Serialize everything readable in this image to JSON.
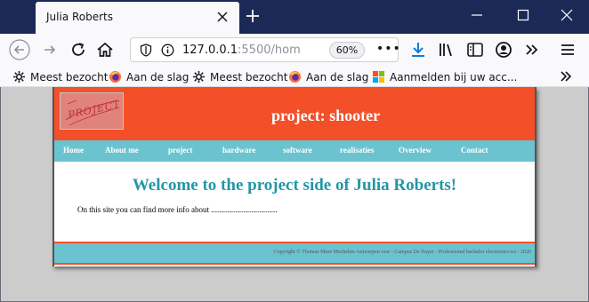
{
  "browser": {
    "tab_title": "Julia Roberts",
    "url_main": "127.0.0.1",
    "url_rest": ":5500/hom",
    "zoom": "60%",
    "accent": "#0b7dd8"
  },
  "bookmarks": [
    {
      "label": "Meest bezocht",
      "icon": "gear-icon"
    },
    {
      "label": "Aan de slag",
      "icon": "firefox-icon"
    },
    {
      "label": "Meest bezocht",
      "icon": "gear-icon"
    },
    {
      "label": "Aan de slag",
      "icon": "firefox-icon"
    },
    {
      "label": "Aanmelden bij uw acc...",
      "icon": "windows-icon"
    }
  ],
  "site": {
    "logo_text": "PROJECT",
    "title": "project: shooter",
    "menu": [
      "Home",
      "About me",
      "project",
      "hardware",
      "software",
      "realisaties",
      "Overview",
      "Contact"
    ],
    "welcome": "Welcome to the project side of Julia Roberts!",
    "intro": "On this site you can find more info about .................................",
    "footer": "Copyright © Thomas More Mechelen-Antwerpen vzw - Campus De Nayer - Professional bachelor electronics-ict - 2020",
    "colors": {
      "header": "#f34f28",
      "menu": "#6cc3d0",
      "welcome": "#2596a6"
    }
  }
}
